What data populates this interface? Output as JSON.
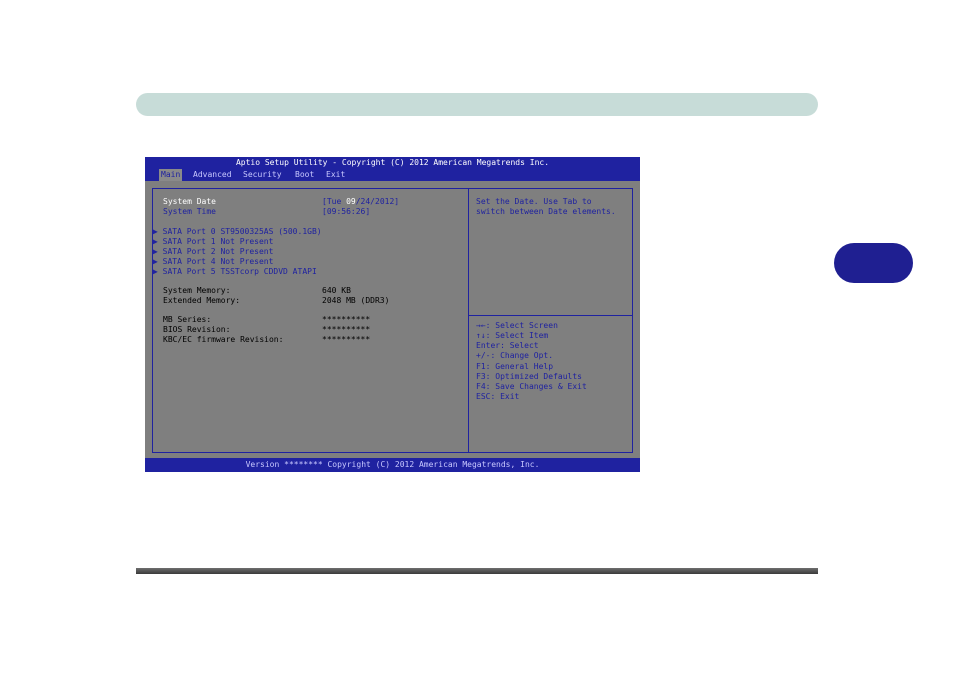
{
  "page": {
    "chapter_tab_color": "#1f1f91",
    "header_color": "#c7dcd8"
  },
  "bios": {
    "title": "Aptio Setup Utility - Copyright (C) 2012 American Megatrends Inc.",
    "menu": [
      "Main",
      "Advanced",
      "Security",
      "Boot",
      "Exit"
    ],
    "active_menu": "Main",
    "date_label": "System Date",
    "date_open": "[Tue ",
    "date_month": "09",
    "date_rest": "/24/2012]",
    "time_label": "System Time",
    "time_value": "[09:56:26]",
    "sata_ports": [
      "SATA Port 0 ST9500325AS (500.1GB)",
      "SATA Port 1 Not Present",
      "SATA Port 2 Not Present",
      "SATA Port 4 Not Present",
      "SATA Port 5 TSSTcorp CDDVD ATAPI"
    ],
    "system_memory_label": "System Memory:",
    "system_memory_value": "640 KB",
    "extended_memory_label": "Extended Memory:",
    "extended_memory_value": "2048 MB (DDR3)",
    "mb_series_label": "MB Series:",
    "mb_series_value": "**********",
    "bios_revision_label": "BIOS Revision:",
    "bios_revision_value": "**********",
    "kbc_label": "KBC/EC firmware Revision:",
    "kbc_value": "**********",
    "help_text_1": "Set the Date. Use Tab to",
    "help_text_2": "switch between Date elements.",
    "keys": [
      "→←: Select Screen",
      "↑↓: Select Item",
      "Enter: Select",
      "+/-: Change Opt.",
      "F1: General Help",
      "F3: Optimized Defaults",
      "F4: Save Changes & Exit",
      "ESC: Exit"
    ],
    "footer": "Version ******** Copyright (C) 2012 American Megatrends, Inc.",
    "colors": {
      "bar_blue": "#1f22a0",
      "panel_gray": "#7f7f7f"
    }
  }
}
